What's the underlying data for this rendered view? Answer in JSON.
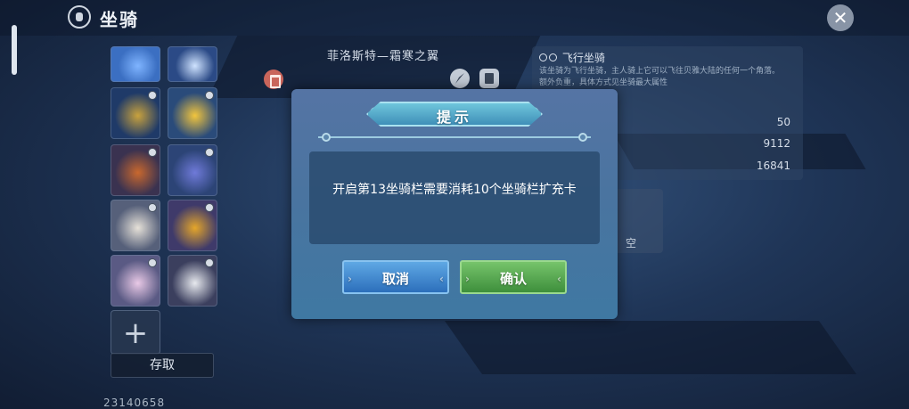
{
  "header": {
    "title": "坐骑"
  },
  "mount_list": {
    "slots": [
      {
        "name": "mount-slot-1",
        "color": "#3b6fc2",
        "accent": "#7fb4ff"
      },
      {
        "name": "mount-slot-2",
        "color": "#2b4a86",
        "accent": "#cfe3ff"
      },
      {
        "name": "mount-slot-3",
        "color": "#1f3a68",
        "accent": "#c9a23d"
      },
      {
        "name": "mount-slot-4",
        "color": "#2a4b7a",
        "accent": "#f2c53d"
      },
      {
        "name": "mount-slot-5",
        "color": "#3a3250",
        "accent": "#c9682e"
      },
      {
        "name": "mount-slot-6",
        "color": "#2c4476",
        "accent": "#6f7ad9"
      },
      {
        "name": "mount-slot-7",
        "color": "#56607a",
        "accent": "#e6e1d8"
      },
      {
        "name": "mount-slot-8",
        "color": "#3f3a6a",
        "accent": "#e5a62a"
      },
      {
        "name": "mount-slot-9",
        "color": "#5a5a84",
        "accent": "#e9c9e6"
      },
      {
        "name": "mount-slot-10",
        "color": "#3b3f5e",
        "accent": "#e7e9ee"
      }
    ],
    "storage_label": "存取",
    "add_label": "+"
  },
  "player_id": "23140658",
  "mount_detail": {
    "name": "菲洛斯特—霜寒之翼",
    "info_title": "飞行坐骑",
    "info_desc_1": "该坐骑为飞行坐骑，主人骑上它可以飞往贝雅大陆的任何一个角落。",
    "info_desc_2": "额外负重，具体方式见坐骑最大属性",
    "stats": [
      "50",
      "9112",
      "16841"
    ],
    "skill_label": "空"
  },
  "dialog": {
    "title": "提示",
    "message": "开启第13坐骑栏需要消耗10个坐骑栏扩充卡",
    "cancel_label": "取消",
    "confirm_label": "确认"
  }
}
